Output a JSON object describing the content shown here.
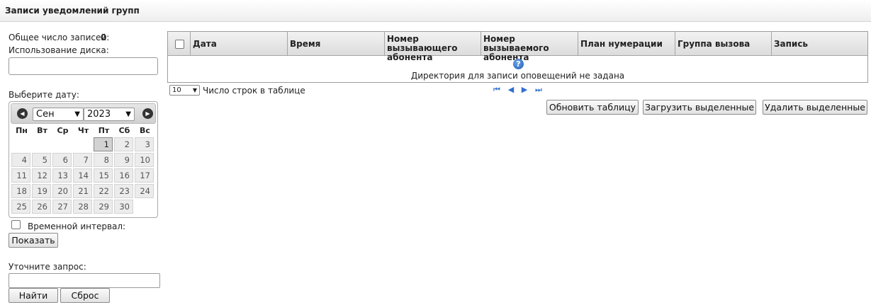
{
  "header": {
    "title": "Записи уведомлений групп"
  },
  "left": {
    "total_label": "Общее число записей:",
    "total_value": "0",
    "disk_label": "Использование диска:",
    "disk_value": "",
    "choose_date_label": "Выберите дату:",
    "interval_label": "Временной интервал:",
    "show_button": "Показать",
    "refine_label": "Уточните запрос:",
    "refine_value": "",
    "find_button": "Найти",
    "reset_button": "Сброс"
  },
  "calendar": {
    "prev_icon": "arrow-left-icon",
    "next_icon": "arrow-right-icon",
    "month": "Сен",
    "year": "2023",
    "weekdays": [
      "Пн",
      "Вт",
      "Ср",
      "Чт",
      "Пт",
      "Сб",
      "Вс"
    ],
    "selected_day": "1",
    "days": [
      "1",
      "2",
      "3",
      "4",
      "5",
      "6",
      "7",
      "8",
      "9",
      "10",
      "11",
      "12",
      "13",
      "14",
      "15",
      "16",
      "17",
      "18",
      "19",
      "20",
      "21",
      "22",
      "23",
      "24",
      "25",
      "26",
      "27",
      "28",
      "29",
      "30"
    ]
  },
  "table": {
    "columns": [
      "Дата",
      "Время",
      "Номер вызывающего абонента",
      "Номер вызываемого абонента",
      "План нумерации",
      "Группа вызова",
      "Запись"
    ],
    "empty_icon": "help-question-icon",
    "empty_message": "Директория для записи оповещений не задана",
    "rows_per_page": "10",
    "rows_per_page_label": "Число строк в таблице",
    "pager_icons": [
      "first-page-icon",
      "prev-page-icon",
      "next-page-icon",
      "last-page-icon"
    ]
  },
  "actions": {
    "refresh": "Обновить таблицу",
    "download": "Загрузить выделенные",
    "delete": "Удалить выделенные"
  },
  "colors": {
    "accent": "#2f6fd1",
    "header_bg": "#eeeeee"
  }
}
